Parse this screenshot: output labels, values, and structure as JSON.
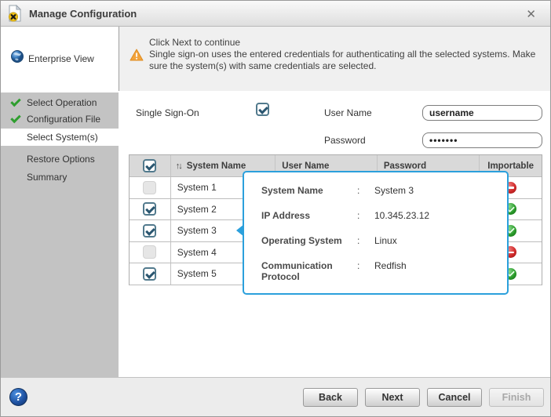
{
  "window": {
    "title": "Manage Configuration",
    "close_glyph": "✕"
  },
  "sidebar": {
    "root_label": "Enterprise View",
    "items": [
      {
        "label": "Select Operation",
        "checked": true,
        "active": false
      },
      {
        "label": "Configuration File",
        "checked": true,
        "active": false
      },
      {
        "label": "Select System(s)",
        "checked": false,
        "active": true
      },
      {
        "label": "Restore Options",
        "checked": false,
        "active": false
      },
      {
        "label": "Summary",
        "checked": false,
        "active": false
      }
    ]
  },
  "banner": {
    "line1": "Click Next to continue",
    "line2": "Single sign-on uses the entered credentials for authenticating all the selected systems. Make sure the system(s) with same credentials are selected."
  },
  "form": {
    "sso_label": "Single Sign-On",
    "sso_checked": true,
    "username_label": "User Name",
    "username_value": "username",
    "password_label": "Password",
    "password_value": "•••••••"
  },
  "table": {
    "sort_glyph": "↑↓",
    "header_checked": true,
    "headers": {
      "name": "System Name",
      "user": "User Name",
      "password": "Password",
      "importable": "Importable"
    },
    "rows": [
      {
        "name": "System 1",
        "checked": false,
        "importable": "red"
      },
      {
        "name": "System 2",
        "checked": true,
        "importable": "green"
      },
      {
        "name": "System 3",
        "checked": true,
        "importable": "green"
      },
      {
        "name": "System 4",
        "checked": false,
        "importable": "red"
      },
      {
        "name": "System 5",
        "checked": true,
        "importable": "green"
      }
    ]
  },
  "tooltip": {
    "separator": ":",
    "rows": [
      {
        "label": "System Name",
        "value": "System 3"
      },
      {
        "label": "IP Address",
        "value": "10.345.23.12"
      },
      {
        "label": "Operating System",
        "value": "Linux"
      },
      {
        "label": "Communication Protocol",
        "value": "Redfish"
      }
    ]
  },
  "footer": {
    "help_glyph": "?",
    "buttons": [
      {
        "label": "Back",
        "disabled": false
      },
      {
        "label": "Next",
        "disabled": false
      },
      {
        "label": "Cancel",
        "disabled": false
      },
      {
        "label": "Finish",
        "disabled": true
      }
    ]
  },
  "colors": {
    "tooltip_border": "#2ba0dc",
    "checkbox_teal": "#2a5670",
    "nav_check_green": "#2f9e2f",
    "orb_red": "#d22b2b",
    "orb_green": "#2d9e2d",
    "warning_orange": "#f2a33c",
    "help_blue": "#1d4f9e",
    "sidebar_gray": "#c3c3c3"
  }
}
